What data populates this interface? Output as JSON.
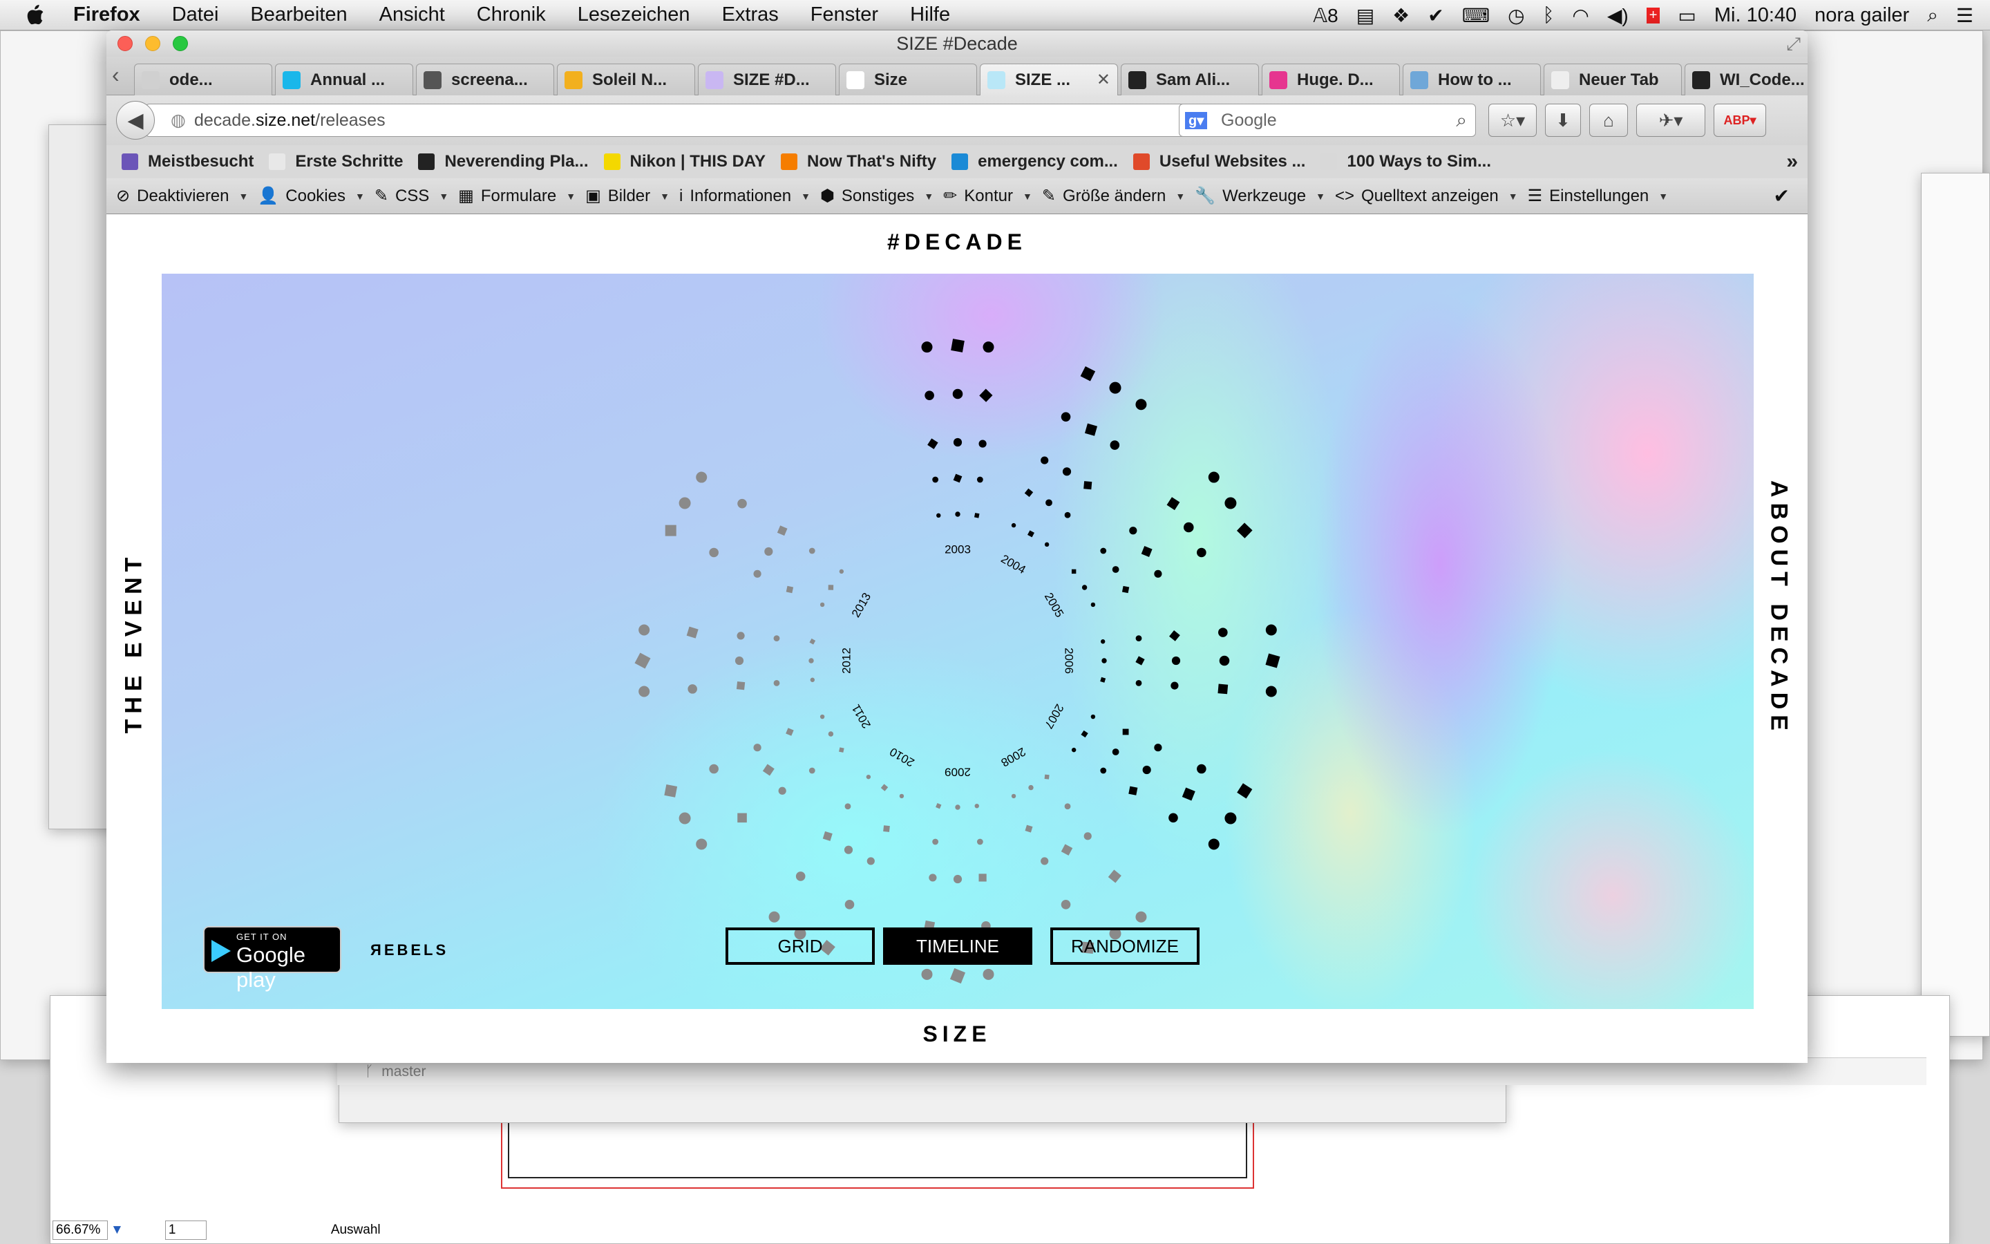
{
  "menubar": {
    "app": "Firefox",
    "items": [
      "Datei",
      "Bearbeiten",
      "Ansicht",
      "Chronik",
      "Lesezeichen",
      "Extras",
      "Fenster",
      "Hilfe"
    ],
    "adobe_badge": "8",
    "clock": "Mi. 10:40",
    "user": "nora gailer"
  },
  "window": {
    "title": "SIZE #Decade"
  },
  "tabs": [
    {
      "label": "ode...",
      "color": "#d0d0d0"
    },
    {
      "label": "Annual ...",
      "color": "#1ab7ea"
    },
    {
      "label": "screena...",
      "color": "#555555"
    },
    {
      "label": "Soleil N...",
      "color": "#f2b01e"
    },
    {
      "label": "SIZE #D...",
      "color": "#c9b7f2"
    },
    {
      "label": "Size",
      "color": "#ffffff"
    },
    {
      "label": "SIZE ...",
      "color": "#b9e7f7",
      "active": true
    },
    {
      "label": "Sam Ali...",
      "color": "#222222"
    },
    {
      "label": "Huge. D...",
      "color": "#e6358f"
    },
    {
      "label": "How to ...",
      "color": "#6fa7d8"
    },
    {
      "label": "Neuer Tab",
      "color": "#eeeeee"
    },
    {
      "label": "WI_Code...",
      "color": "#222222"
    }
  ],
  "url": {
    "prefix": "decade.",
    "domain": "size.net",
    "path": "/releases"
  },
  "search": {
    "placeholder": "Google"
  },
  "bookmarks": [
    {
      "label": "Meistbesucht",
      "color": "#6b55b8"
    },
    {
      "label": "Erste Schritte",
      "color": "#e8e8e8"
    },
    {
      "label": "Neverending Pla...",
      "color": "#222222"
    },
    {
      "label": "Nikon | THIS DAY",
      "color": "#f4d800"
    },
    {
      "label": "Now That's Nifty",
      "color": "#f57d00"
    },
    {
      "label": "emergency com...",
      "color": "#1b8ad6"
    },
    {
      "label": "Useful Websites ...",
      "color": "#e04a2a"
    },
    {
      "label": "100 Ways to Sim...",
      "color": "#d8d8d8"
    }
  ],
  "devbar": [
    {
      "label": "Deaktivieren",
      "icon": "⊘"
    },
    {
      "label": "Cookies",
      "icon": "👤"
    },
    {
      "label": "CSS",
      "icon": "✎"
    },
    {
      "label": "Formulare",
      "icon": "▦"
    },
    {
      "label": "Bilder",
      "icon": "▣"
    },
    {
      "label": "Informationen",
      "icon": "i"
    },
    {
      "label": "Sonstiges",
      "icon": "⬢"
    },
    {
      "label": "Kontur",
      "icon": "✏"
    },
    {
      "label": "Größe ändern",
      "icon": "✎"
    },
    {
      "label": "Werkzeuge",
      "icon": "🔧"
    },
    {
      "label": "Quelltext anzeigen",
      "icon": "<>"
    },
    {
      "label": "Einstellungen",
      "icon": "☰"
    }
  ],
  "page": {
    "logo_top": "#DECADE",
    "logo_bottom": "SIZE",
    "side_left": "THE EVENT",
    "side_right": "ABOUT DECADE",
    "gplay_small": "GET IT ON",
    "gplay_big": "Google play",
    "rebels": "ЯEBELS",
    "buttons": {
      "grid": "GRID",
      "timeline": "TIMELINE",
      "randomize": "RANDOMIZE"
    },
    "years": [
      "2003",
      "2004",
      "2005",
      "2006",
      "2007",
      "2008",
      "2009",
      "2010",
      "2011",
      "2012",
      "2013"
    ]
  },
  "illustrator": {
    "zoom": "66.67%",
    "page": "1",
    "mode": "Auswahl"
  },
  "github": {
    "branch": "master"
  }
}
